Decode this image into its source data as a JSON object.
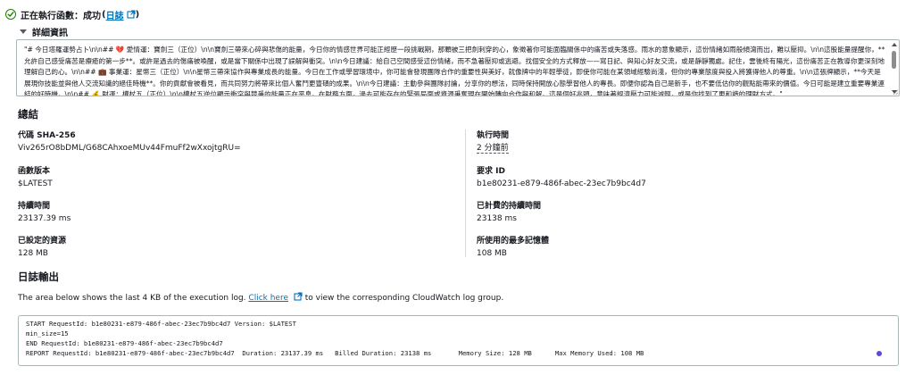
{
  "status": {
    "title": "正在執行函數：成功",
    "log_link": "日誌",
    "paren_open": "(",
    "paren_close": ")"
  },
  "details": {
    "label": "詳細資訊",
    "text": "\"# 今日塔羅運勢占卜\\n\\n## 💔 愛情運：寶劍三（正位）\\n\\n寶劍三帶來心碎與悲傷的能量，今日你的情感世界可能正經歷一段挑戰期，那顆被三把劍刺穿的心，象徵著你可能面臨關係中的痛苦或失落感。雨水的意象顯示，這份情緒如雨般傾瀉而出，難以壓抑。\\n\\n這股能量提醒你，**允許自己感受痛苦是療癒的第一步**。或許是過去的傷痛被喚醒，或是當下關係中出現了誤解與衝突。\\n\\n今日建議：給自己空間感受這份情緒，而不急著壓抑或逃避。找個安全的方式釋放——寫日記、與知心好友交流，或是靜靜獨處。記住，雲後終有陽光，這份痛苦正在教導你更深刻地理解自己的心。\\n\\n## 💼 事業運：星幣三（正位）\\n\\n星幣三帶來協作與專業成長的能量。今日在工作或學習環境中，你可能會發現團隊合作的重要性與美好，就像牌中的年輕學徒，即使你可能在某領域經驗尚淺，但你的專業態度與投入將獲得他人的尊重。\\n\\n這張牌顯示，**今天是展現你技能並與他人交流知識的絕佳時機**。你的貢獻會被看見，而共同努力將帶來比個人奮鬥更豐碩的成果。\\n\\n今日建議：主動參與團隊討論，分享你的想法，同時保持開放心態學習他人的專長。即便你認為自己是新手，也不要低估你的觀點能帶來的價值。今日可能是建立重要專業連結的好時機。\\n\\n## 💰 財運：權杖五（正位）\\n\\n權杖五逆位顯示衝突與競爭的能量正在平息。在財務方面，過去可能存在的緊張局面或資源爭奪現在開始轉向合作與和解。這是個好兆頭，意味著經濟壓力可能減輕，或是你找到了更和諧的理財方式。\""
  },
  "summary": {
    "title": "總結",
    "code_label": "代碼 SHA-256",
    "code_value": "Viv265rO8bDML/G68CAhxoeMUv44FmuFf2wXxojtgRU=",
    "exec_time_label": "執行時間",
    "exec_time_value": "2 分鐘前",
    "version_label": "函數版本",
    "version_value": "$LATEST",
    "request_label": "要求 ID",
    "request_value": "b1e80231-e879-486f-abec-23ec7b9bc4d7",
    "duration_label": "持續時間",
    "duration_value": "23137.39 ms",
    "billed_label": "已計費的持續時間",
    "billed_value": "23138 ms",
    "resource_label": "已設定的資源",
    "resource_value": "128 MB",
    "memory_label": "所使用的最多記憶體",
    "memory_value": "108 MB"
  },
  "logs": {
    "title": "日誌輸出",
    "desc_prefix": "The area below shows the last 4 KB of the execution log.",
    "click_here": "Click here",
    "desc_suffix": "to view the corresponding CloudWatch log group.",
    "lines": [
      "START RequestId: b1e80231-e879-486f-abec-23ec7b9bc4d7 Version: $LATEST",
      "min_size=15",
      "END RequestId: b1e80231-e879-486f-abec-23ec7b9bc4d7",
      "REPORT RequestId: b1e80231-e879-486f-abec-23ec7b9bc4d7  Duration: 23137.39 ms   Billed Duration: 23138 ms       Memory Size: 128 MB      Max Memory Used: 108 MB"
    ]
  },
  "colors": {
    "success": "#1d8102",
    "link": "#0073bb",
    "text": "#16191f",
    "border": "#aab7b8",
    "dot": "#5b4bd6"
  },
  "icons": [
    "success-check-icon",
    "external-link-icon",
    "caret-down-icon",
    "status-dot-icon"
  ]
}
